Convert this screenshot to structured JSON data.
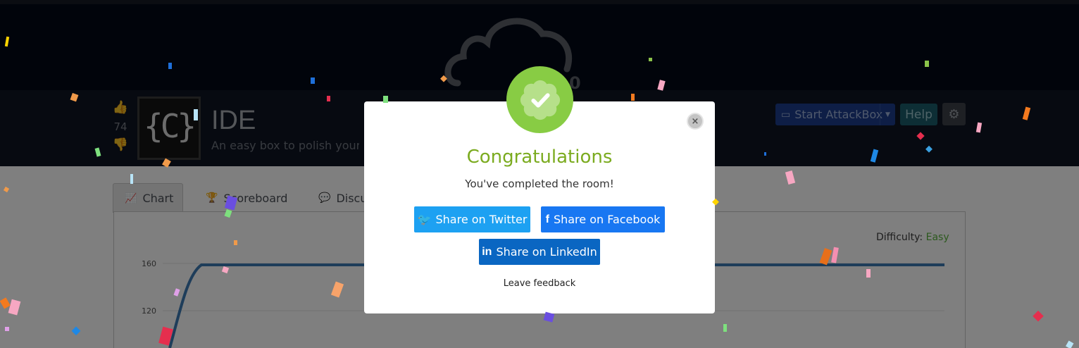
{
  "room": {
    "votes": "74",
    "icon_text": "{C}",
    "title": "IDE",
    "description": "An easy box to polish your enu"
  },
  "header_actions": {
    "start_attackbox_label": "Start AttackBox",
    "help_label": "Help"
  },
  "tabs": [
    {
      "label": "Chart",
      "icon": "chart-line-icon"
    },
    {
      "label": "Scoreboard",
      "icon": "trophy-icon"
    },
    {
      "label": "Discu",
      "icon": "comments-icon"
    }
  ],
  "chart_data": {
    "type": "line",
    "y_ticks": [
      "160",
      "120"
    ],
    "difficulty_label": "Difficulty:",
    "difficulty_value": "Easy",
    "series": [
      {
        "values": [
          0,
          160,
          160,
          160
        ]
      }
    ]
  },
  "modal": {
    "title": "Congratulations",
    "subtitle": "You've completed the room!",
    "share_twitter": "Share on Twitter",
    "share_facebook": "Share on Facebook",
    "share_linkedin": "Share on LinkedIn",
    "feedback": "Leave feedback",
    "close_symbol": "×"
  },
  "colors": {
    "accent_green": "#88cc44",
    "title_green": "#7bab1f",
    "twitter": "#1da1f2",
    "facebook": "#1877f2",
    "linkedin": "#0a66c2"
  }
}
